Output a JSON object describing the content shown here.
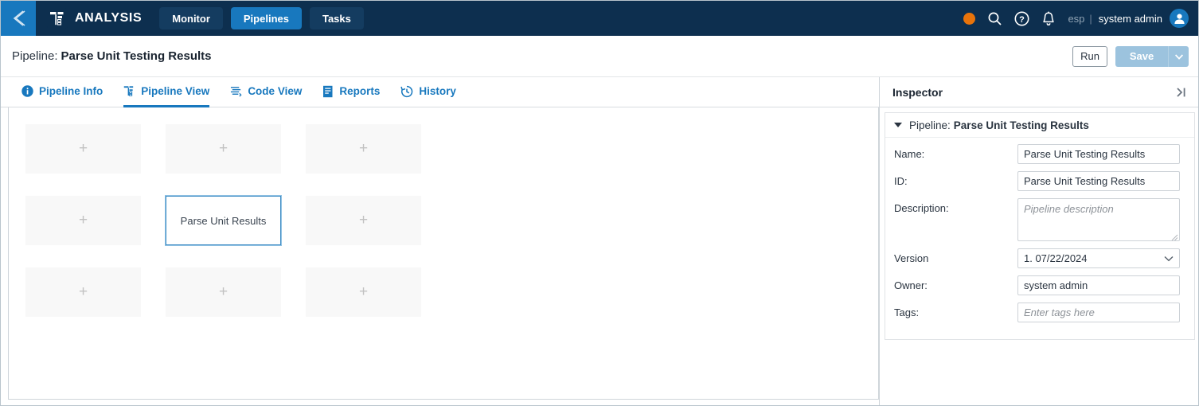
{
  "topnav": {
    "back_icon": "chevron-left-icon",
    "brand_icon": "analysis-logo-icon",
    "brand": "ANALYSIS",
    "tabs": [
      {
        "label": "Monitor",
        "active": false
      },
      {
        "label": "Pipelines",
        "active": true
      },
      {
        "label": "Tasks",
        "active": false
      }
    ],
    "status_dot_color": "#e8730a",
    "icons": [
      "search-icon",
      "help-icon",
      "notification-bell-icon"
    ],
    "locale": "esp",
    "separator": "|",
    "user_name": "system admin",
    "avatar_icon": "user-avatar-icon"
  },
  "titlebar": {
    "prefix": "Pipeline:",
    "name": "Parse Unit Testing Results",
    "run_label": "Run",
    "save_label": "Save",
    "save_caret_icon": "caret-down-icon"
  },
  "subtabs": [
    {
      "label": "Pipeline Info",
      "icon": "info-circle-icon",
      "active": false
    },
    {
      "label": "Pipeline View",
      "icon": "pipeline-view-icon",
      "active": true
    },
    {
      "label": "Code View",
      "icon": "code-view-icon",
      "active": false
    },
    {
      "label": "Reports",
      "icon": "report-document-icon",
      "active": false
    },
    {
      "label": "History",
      "icon": "history-clock-icon",
      "active": false
    }
  ],
  "canvas": {
    "add_glyph": "+",
    "cells": [
      {
        "type": "empty"
      },
      {
        "type": "empty"
      },
      {
        "type": "empty"
      },
      {
        "type": "empty"
      },
      {
        "type": "node",
        "label": "Parse Unit Results"
      },
      {
        "type": "empty"
      },
      {
        "type": "empty"
      },
      {
        "type": "empty"
      },
      {
        "type": "empty"
      }
    ]
  },
  "inspector": {
    "title": "Inspector",
    "collapse_icon": "collapse-panel-right-icon",
    "section": {
      "prefix": "Pipeline:",
      "name": "Parse Unit Testing Results",
      "expanded": true
    },
    "fields": {
      "name_label": "Name:",
      "name_value": "Parse Unit Testing Results",
      "id_label": "ID:",
      "id_value": "Parse Unit Testing Results",
      "description_label": "Description:",
      "description_placeholder": "Pipeline description",
      "version_label": "Version",
      "version_value": "1. 07/22/2024",
      "owner_label": "Owner:",
      "owner_value": "system admin",
      "tags_label": "Tags:",
      "tags_placeholder": "Enter tags here"
    }
  },
  "colors": {
    "nav_bg": "#0d2f4f",
    "accent": "#1878be",
    "status": "#e8730a",
    "save_disabled": "#9cc3de"
  }
}
